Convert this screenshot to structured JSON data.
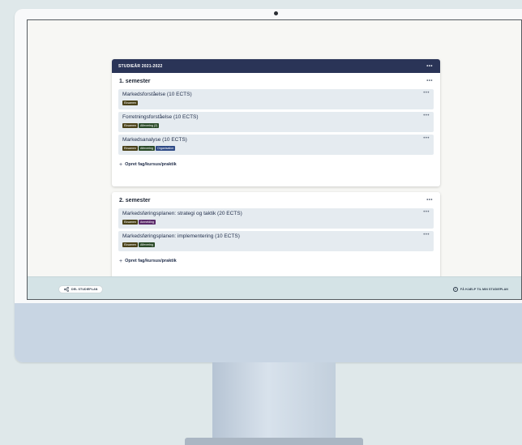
{
  "study_year": {
    "label": "STUDIEÅR 2021-2022",
    "menu_icon": "more-horizontal-icon"
  },
  "semesters": [
    {
      "title": "1. semester",
      "courses": [
        {
          "title": "Markedsforståelse (10 ECTS)",
          "tags": [
            {
              "label": "Eksamen",
              "color": "#4a4219"
            }
          ]
        },
        {
          "title": "Forretningsforståelse (10 ECTS)",
          "tags": [
            {
              "label": "Eksamen",
              "color": "#4a4219"
            },
            {
              "label": "Aflevering (2)",
              "color": "#2a4a28"
            }
          ]
        },
        {
          "title": "Markedsanalyse (10 ECTS)",
          "tags": [
            {
              "label": "Eksamen",
              "color": "#4a4219"
            },
            {
              "label": "Aflevering",
              "color": "#2a4a28"
            },
            {
              "label": "Organisation",
              "color": "#2e4a86"
            }
          ]
        }
      ],
      "add_label": "Opret fag/kursus/praktik"
    },
    {
      "title": "2. semester",
      "courses": [
        {
          "title": "Markedsføringsplanen: strategi og taktik (20 ECTS)",
          "tags": [
            {
              "label": "Eksamen",
              "color": "#4a4219"
            },
            {
              "label": "Anmelding",
              "color": "#5b2a6a"
            }
          ]
        },
        {
          "title": "Markedsføringsplanen: implementering (10 ECTS)",
          "tags": [
            {
              "label": "Eksamen",
              "color": "#4a4219"
            },
            {
              "label": "Aflevering",
              "color": "#2a4a28"
            }
          ]
        }
      ],
      "add_label": "Opret fag/kursus/praktik"
    }
  ],
  "footer": {
    "share_label": "DEL STUDIEPLAN",
    "share_icon": "share-icon",
    "help_label": "FÅ HJÆLP TIL MIN STUDIEPLAN",
    "help_icon": "info-icon"
  },
  "colors": {
    "header": "#2a3457",
    "course_bg": "#e5ebf0",
    "footer_bar": "#d4e3e6"
  }
}
